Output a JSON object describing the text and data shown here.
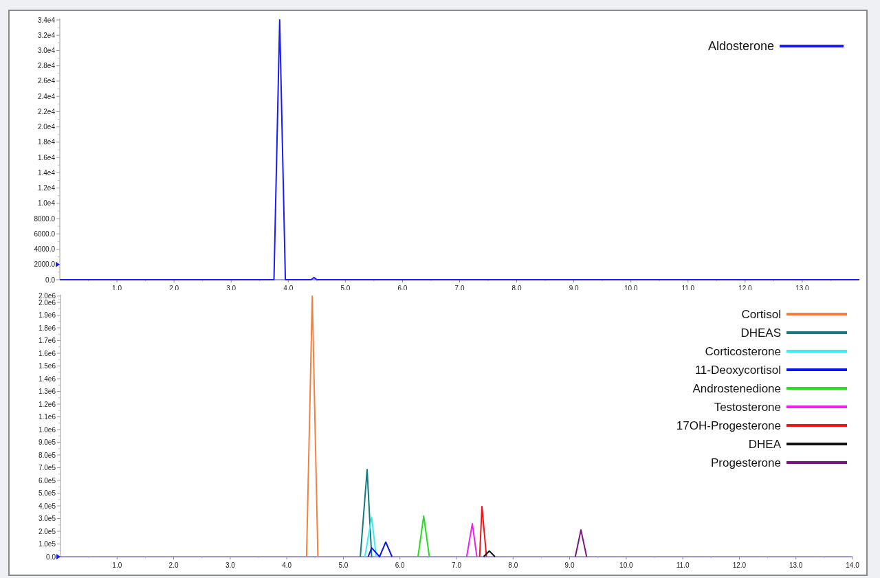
{
  "charts": [
    {
      "chart_data": {
        "type": "line",
        "x": [
          0,
          3.75,
          3.85,
          3.95,
          4.4,
          4.45,
          4.5,
          14
        ],
        "series": [
          {
            "name": "Aldosterone",
            "color": "#1a1aff",
            "values": [
              0,
              0,
              34000,
              0,
              0,
              300,
              0,
              0
            ]
          }
        ],
        "xlim": [
          0,
          14
        ],
        "ylim": [
          0,
          34000
        ],
        "xticks": [
          {
            "value": 1,
            "label": "1.0"
          },
          {
            "value": 2,
            "label": "2.0"
          },
          {
            "value": 3,
            "label": "3.0"
          },
          {
            "value": 4,
            "label": "4.0"
          },
          {
            "value": 5,
            "label": "5.0"
          },
          {
            "value": 6,
            "label": "6.0"
          },
          {
            "value": 7,
            "label": "7.0"
          },
          {
            "value": 8,
            "label": "8.0"
          },
          {
            "value": 9,
            "label": "9.0"
          },
          {
            "value": 10,
            "label": "10.0"
          },
          {
            "value": 11,
            "label": "11.0"
          },
          {
            "value": 12,
            "label": "12.0"
          },
          {
            "value": 13,
            "label": "13.0"
          }
        ],
        "yticks": [
          {
            "value": 0,
            "label": "0.0"
          },
          {
            "value": 2000,
            "label": "2000.0"
          },
          {
            "value": 4000,
            "label": "4000.0"
          },
          {
            "value": 6000,
            "label": "6000.0"
          },
          {
            "value": 8000,
            "label": "8000.0"
          },
          {
            "value": 10000,
            "label": "1.0e4"
          },
          {
            "value": 12000,
            "label": "1.2e4"
          },
          {
            "value": 14000,
            "label": "1.4e4"
          },
          {
            "value": 16000,
            "label": "1.6e4"
          },
          {
            "value": 18000,
            "label": "1.8e4"
          },
          {
            "value": 20000,
            "label": "2.0e4"
          },
          {
            "value": 22000,
            "label": "2.2e4"
          },
          {
            "value": 24000,
            "label": "2.4e4"
          },
          {
            "value": 26000,
            "label": "2.6e4"
          },
          {
            "value": 28000,
            "label": "2.8e4"
          },
          {
            "value": 30000,
            "label": "3.0e4"
          },
          {
            "value": 32000,
            "label": "3.2e4"
          },
          {
            "value": 34000,
            "label": "3.4e4"
          }
        ]
      }
    },
    {
      "chart_data": {
        "type": "line",
        "x": [
          4.35,
          4.45,
          4.55,
          5.3,
          5.38,
          5.42,
          5.44,
          5.5,
          5.58,
          5.64,
          5.75,
          5.86,
          6.32,
          6.42,
          6.52,
          7.18,
          7.28,
          7.36,
          7.41,
          7.45,
          7.48,
          7.53,
          7.58,
          7.68,
          9.1,
          9.2,
          9.3
        ],
        "series": [
          {
            "name": "Cortisol",
            "color": "#f5803e",
            "values": [
              0,
              2050000,
              0,
              null,
              null,
              null,
              null,
              null,
              null,
              null,
              null,
              null,
              null,
              null,
              null,
              null,
              null,
              null,
              null,
              null,
              null,
              null,
              null,
              null,
              null,
              null,
              null
            ]
          },
          {
            "name": "DHEAS",
            "color": "#137a7f",
            "values": [
              null,
              null,
              null,
              0,
              null,
              685000,
              null,
              0,
              null,
              null,
              null,
              null,
              null,
              null,
              null,
              null,
              null,
              null,
              null,
              null,
              null,
              null,
              null,
              null,
              null,
              null,
              null
            ]
          },
          {
            "name": "Corticosterone",
            "color": "#33f0f5",
            "values": [
              null,
              null,
              null,
              null,
              0,
              null,
              null,
              310000,
              0,
              null,
              null,
              null,
              null,
              null,
              null,
              null,
              null,
              null,
              null,
              null,
              null,
              null,
              null,
              null,
              null,
              null,
              null
            ]
          },
          {
            "name": "11-Deoxycortisol",
            "color": "#0a14e6",
            "values": [
              null,
              null,
              null,
              null,
              null,
              null,
              0,
              70000,
              null,
              0,
              115000,
              0,
              null,
              null,
              null,
              null,
              null,
              null,
              null,
              null,
              null,
              null,
              null,
              null,
              null,
              null,
              null
            ]
          },
          {
            "name": "Androstenedione",
            "color": "#22e01a",
            "values": [
              null,
              null,
              null,
              null,
              null,
              null,
              null,
              null,
              null,
              null,
              null,
              null,
              0,
              320000,
              0,
              null,
              null,
              null,
              null,
              null,
              null,
              null,
              null,
              null,
              null,
              null,
              null
            ]
          },
          {
            "name": "Testosterone",
            "color": "#f01ef0",
            "values": [
              null,
              null,
              null,
              null,
              null,
              null,
              null,
              null,
              null,
              null,
              null,
              null,
              null,
              null,
              null,
              0,
              260000,
              0,
              null,
              null,
              null,
              null,
              null,
              null,
              null,
              null,
              null
            ]
          },
          {
            "name": "17OH-Progesterone",
            "color": "#f01414",
            "values": [
              null,
              null,
              null,
              null,
              null,
              null,
              null,
              null,
              null,
              null,
              null,
              null,
              null,
              null,
              null,
              null,
              null,
              null,
              0,
              395000,
              null,
              0,
              null,
              null,
              null,
              null,
              null
            ]
          },
          {
            "name": "DHEA",
            "color": "#111111",
            "values": [
              null,
              null,
              null,
              null,
              null,
              null,
              null,
              null,
              null,
              null,
              null,
              null,
              null,
              null,
              null,
              null,
              null,
              null,
              null,
              null,
              0,
              null,
              45000,
              0,
              null,
              null,
              null
            ]
          },
          {
            "name": "Progesterone",
            "color": "#7a1580",
            "values": [
              null,
              null,
              null,
              null,
              null,
              null,
              null,
              null,
              null,
              null,
              null,
              null,
              null,
              null,
              null,
              null,
              null,
              null,
              null,
              null,
              null,
              null,
              null,
              null,
              0,
              210000,
              0
            ]
          }
        ],
        "xlim": [
          0,
          14
        ],
        "ylim": [
          0,
          2060000
        ],
        "xticks": [
          {
            "value": 1,
            "label": "1.0"
          },
          {
            "value": 2,
            "label": "2.0"
          },
          {
            "value": 3,
            "label": "3.0"
          },
          {
            "value": 4,
            "label": "4.0"
          },
          {
            "value": 5,
            "label": "5.0"
          },
          {
            "value": 6,
            "label": "6.0"
          },
          {
            "value": 7,
            "label": "7.0"
          },
          {
            "value": 8,
            "label": "8.0"
          },
          {
            "value": 9,
            "label": "9.0"
          },
          {
            "value": 10,
            "label": "10.0"
          },
          {
            "value": 11,
            "label": "11.0"
          },
          {
            "value": 12,
            "label": "12.0"
          },
          {
            "value": 13,
            "label": "13.0"
          },
          {
            "value": 14,
            "label": "14.0"
          }
        ],
        "yticks": [
          {
            "value": 0,
            "label": "0.0"
          },
          {
            "value": 100000,
            "label": "1.0e5"
          },
          {
            "value": 200000,
            "label": "2.0e5"
          },
          {
            "value": 300000,
            "label": "3.0e5"
          },
          {
            "value": 400000,
            "label": "4.0e5"
          },
          {
            "value": 500000,
            "label": "5.0e5"
          },
          {
            "value": 600000,
            "label": "6.0e5"
          },
          {
            "value": 700000,
            "label": "7.0e5"
          },
          {
            "value": 800000,
            "label": "8.0e5"
          },
          {
            "value": 900000,
            "label": "9.0e5"
          },
          {
            "value": 1000000,
            "label": "1.0e6"
          },
          {
            "value": 1100000,
            "label": "1.1e6"
          },
          {
            "value": 1200000,
            "label": "1.2e6"
          },
          {
            "value": 1300000,
            "label": "1.3e6"
          },
          {
            "value": 1400000,
            "label": "1.4e6"
          },
          {
            "value": 1500000,
            "label": "1.5e6"
          },
          {
            "value": 1600000,
            "label": "1.6e6"
          },
          {
            "value": 1700000,
            "label": "1.7e6"
          },
          {
            "value": 1800000,
            "label": "1.8e6"
          },
          {
            "value": 1900000,
            "label": "1.9e6"
          },
          {
            "value": 2000000,
            "label": "2.0e6"
          },
          {
            "value": 2050000,
            "label": "2.0e6"
          }
        ]
      }
    }
  ]
}
